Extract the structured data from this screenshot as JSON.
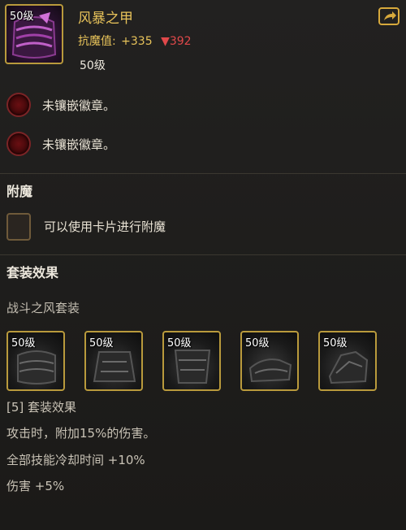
{
  "item": {
    "level_tag": "50级",
    "name": "风暴之甲",
    "stat_label": "抗魔值:",
    "stat_up": "+335",
    "stat_down": "▼392",
    "req_level": "50级"
  },
  "sockets": [
    {
      "label": "未镶嵌徽章。"
    },
    {
      "label": "未镶嵌徽章。"
    }
  ],
  "enchant": {
    "title": "附魔",
    "slot_label": "可以使用卡片进行附魔"
  },
  "set": {
    "title": "套装效果",
    "name": "战斗之风套装",
    "pieces": [
      {
        "level": "50级"
      },
      {
        "level": "50级"
      },
      {
        "level": "50级"
      },
      {
        "level": "50级"
      },
      {
        "level": "50级"
      }
    ],
    "bonus_header": "[5] 套装效果",
    "bonuses": [
      "攻击时，附加15%的伤害。",
      "全部技能冷却时间 +10%",
      "伤害 +5%"
    ]
  },
  "colors": {
    "gold": "#e7c25a",
    "stat_down": "#e0484a",
    "socket": "#6a0f12",
    "frame": "#b99a3c"
  },
  "icons": {
    "share": "share-arrow-icon",
    "socket": "empty-socket-icon",
    "enchant": "enchant-slot-icon"
  }
}
